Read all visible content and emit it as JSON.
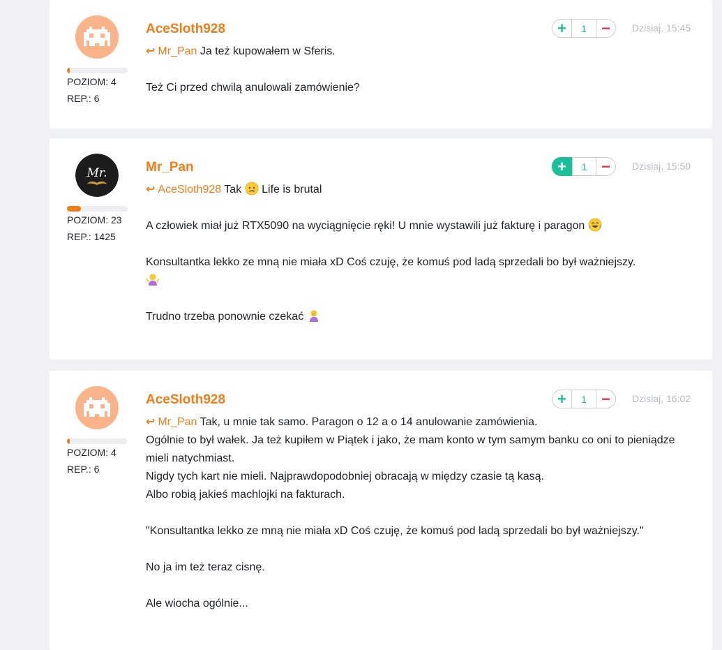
{
  "posts": [
    {
      "username": "AceSloth928",
      "level_label": "POZIOM: 4",
      "rep_label": "REP.: 6",
      "level_progress": 0.04,
      "votes": "1",
      "timestamp": "Dzisiaj, 15:45",
      "reply_to": "Mr_Pan",
      "reply_text": "Ja też kupowałem w Sferis.",
      "paragraphs": [
        "Też Ci przed chwilą anulowali zamówienie?"
      ]
    },
    {
      "username": "Mr_Pan",
      "level_label": "POZIOM: 23",
      "rep_label": "REP.: 1425",
      "level_progress": 0.23,
      "votes": "1",
      "timestamp": "Dzisiaj, 15:50",
      "reply_to": "AceSloth928",
      "reply_text_a": "Tak",
      "reply_text_b": "Life is brutal",
      "paragraphs": [
        "A człowiek miał już RTX5090 na wyciągnięcie ręki! U mnie wystawili już fakturę i paragon",
        "Konsultantka lekko ze mną nie miała xD Coś czuję, że komuś pod ladą sprzedali bo był ważniejszy.",
        "Trudno trzeba ponownie czekać"
      ]
    },
    {
      "username": "AceSloth928",
      "level_label": "POZIOM: 4",
      "rep_label": "REP.: 6",
      "level_progress": 0.04,
      "votes": "1",
      "timestamp": "Dzisiaj, 16:02",
      "reply_to": "Mr_Pan",
      "reply_text": "Tak, u mnie tak samo. Paragon o 12 a o 14 anulowanie zamówienia.",
      "lines": [
        "Ogólnie to był wałek. Ja też kupiłem w Piątek i jako, że mam konto w tym samym banku co oni to pieniądze mieli natychmiast.",
        "Nigdy tych kart nie mieli. Najprawdopodobniej obracają w między czasie tą kasą.",
        "Albo robią jakieś machlojki na fakturach."
      ],
      "quote": "\"Konsultantka lekko ze mną nie miała xD Coś czuję, że komuś pod ladą sprzedali bo był ważniejszy.\"",
      "after_quote": [
        "No ja im też teraz cisnę.",
        "Ale wiocha ogólnie..."
      ]
    }
  ],
  "icons": {
    "reply": "reply-arrow-icon",
    "plus": "+",
    "minus": "−"
  },
  "colors": {
    "accent": "#f07d1a",
    "upvote": "#1bbf9a",
    "downvote": "#e0344b",
    "timestamp": "#b8bcc2"
  }
}
